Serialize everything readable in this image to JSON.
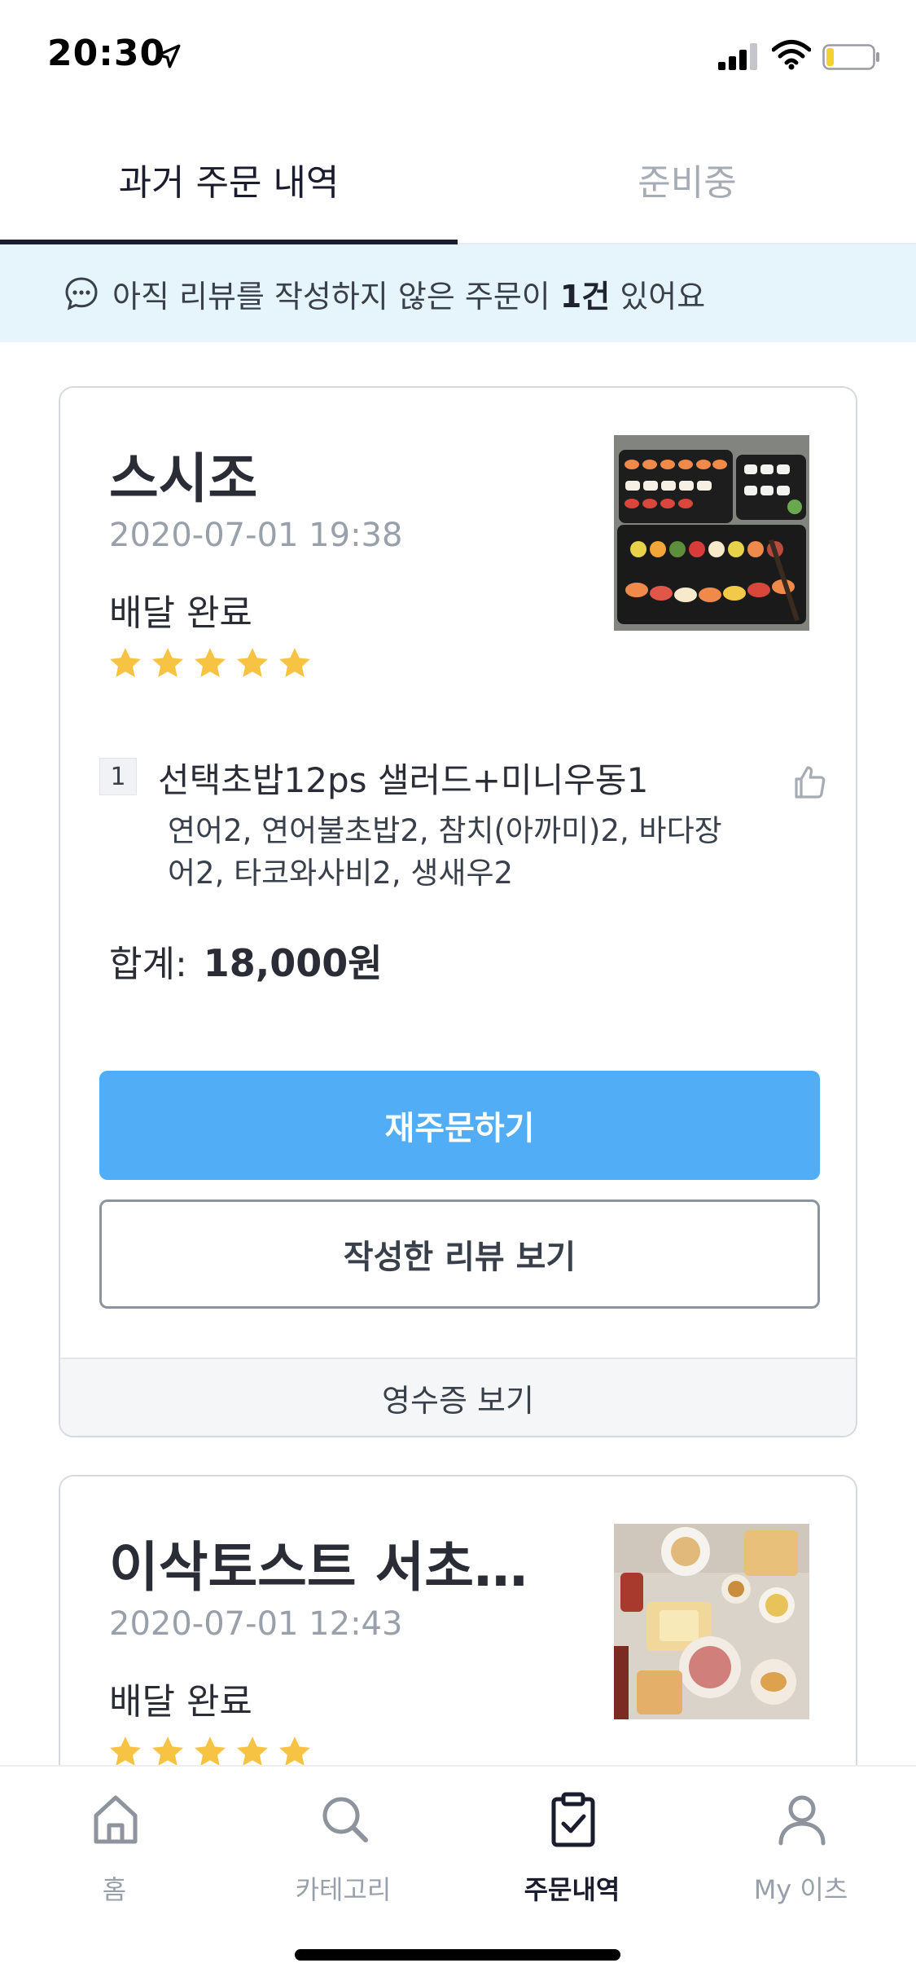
{
  "status_bar": {
    "time": "20:30",
    "icons": [
      "location-arrow-icon",
      "cellular-signal-icon",
      "wifi-icon",
      "battery-icon"
    ]
  },
  "tabs": [
    {
      "label": "과거 주문 내역",
      "active": true
    },
    {
      "label": "준비중",
      "active": false
    }
  ],
  "notice": {
    "prefix": "아직 리뷰를 작성하지 않은 주문이 ",
    "count": "1건",
    "suffix": " 있어요",
    "icon": "chat-bubble-icon"
  },
  "orders": [
    {
      "store": "스시조",
      "date": "2020-07-01 19:38",
      "status": "배달 완료",
      "rating": 5,
      "items": [
        {
          "qty": "1",
          "name": "선택초밥12ps 샐러드+미니우동1",
          "options": "연어2, 연어불초밥2, 참치(아까미)2, 바다장어2, 타코와사비2, 생새우2"
        }
      ],
      "total_label": "합계:",
      "total_value": "18,000원",
      "reorder_label": "재주문하기",
      "review_label": "작성한 리뷰 보기",
      "receipt_label": "영수증 보기"
    },
    {
      "store": "이삭토스트 서초…",
      "date": "2020-07-01 12:43",
      "status": "배달 완료",
      "rating": 5
    }
  ],
  "bottom_nav": [
    {
      "label": "홈",
      "icon": "home-icon",
      "active": false
    },
    {
      "label": "카테고리",
      "icon": "search-icon",
      "active": false
    },
    {
      "label": "주문내역",
      "icon": "clipboard-check-icon",
      "active": true
    },
    {
      "label": "My 이츠",
      "icon": "person-icon",
      "active": false
    }
  ],
  "colors": {
    "primary_button": "#51adf6",
    "star": "#f6c343",
    "notice_bg": "#e6f5fc",
    "active_tab": "#1b1d2f",
    "inactive_text": "#a6abb6"
  }
}
